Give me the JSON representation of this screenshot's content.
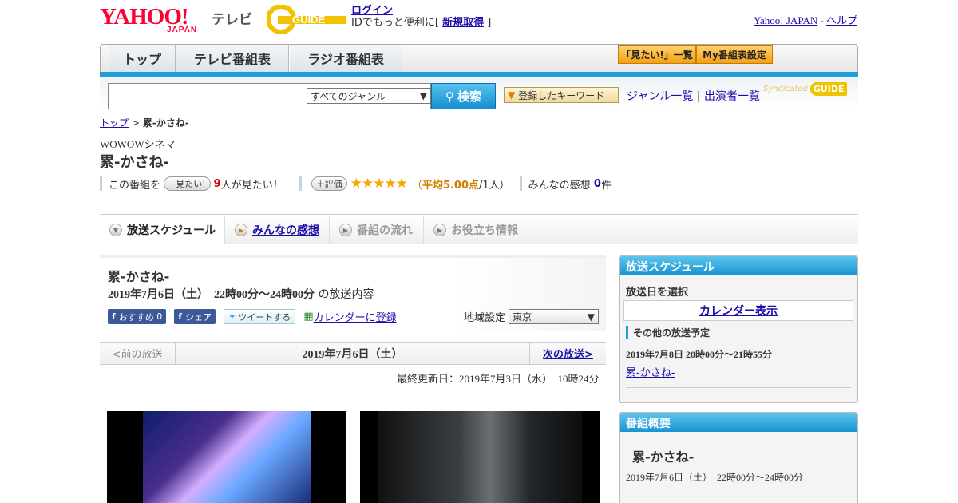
{
  "header": {
    "logo_main": "YAHOO!",
    "logo_sub": "JAPAN",
    "logo_tv": "テレビ",
    "gguide_logo": "GUIDE",
    "login_link": "ログイン",
    "login_text_prefix": "IDでもっと便利に[",
    "register_link": "新規取得",
    "login_text_suffix": "]",
    "yahoo_japan_link": "Yahoo! JAPAN",
    "dash": "-",
    "help_link": "ヘルプ"
  },
  "nav": {
    "tabs": [
      "トップ",
      "テレビ番組表",
      "ラジオ番組表"
    ],
    "mitai_list": "「見たい!」一覧",
    "my_schedule": "My番組表設定"
  },
  "search": {
    "placeholder": "",
    "genre_selected": "すべてのジャンル",
    "search_button": "検索",
    "keyword_button": "登録したキーワード",
    "genre_list_link": "ジャンル一覧",
    "divider": "|",
    "performer_link": "出演者一覧",
    "syndicated": "Syndicated",
    "syndicated_logo": "GUIDE"
  },
  "breadcrumb": {
    "top": "トップ",
    "sep": ">",
    "current": "累-かさね-"
  },
  "program": {
    "channel": "WOWOWシネマ",
    "title": "累-かさね-",
    "mitai_prefix": "この番組を",
    "mitai_button": "見たい!",
    "mitai_count": "9",
    "mitai_suffix": "人が見たい！",
    "rating_button": "評価",
    "stars": "★★★★★",
    "rating_open": "（",
    "rating_avg": "平均5.00点",
    "rating_rest": "/1人）",
    "impressions_label": "みんなの感想",
    "impressions_count": "0",
    "impressions_unit": "件"
  },
  "subtabs": [
    "放送スケジュール",
    "みんなの感想",
    "番組の流れ",
    "お役立ち情報"
  ],
  "main": {
    "title": "累-かさね-",
    "date": "2019年7月6日（土）　22時00分～24時00分",
    "date_suffix": "の放送内容",
    "recommend": "おすすめ",
    "recommend_count": "0",
    "share": "シェア",
    "tweet": "ツイートする",
    "calendar": "カレンダーに登録",
    "region_label": "地域設定",
    "region_value": "東京",
    "prev": "<前の放送",
    "current_date": "2019年7月6日（土）",
    "next": "次の放送>",
    "updated": "最終更新日：2019年7月3日（水）　10時24分"
  },
  "sidebar": {
    "schedule_head": "放送スケジュール",
    "select_date": "放送日を選択",
    "calendar_link": "カレンダー表示",
    "other_label": "その他の放送予定",
    "other_date": "2019年7月8日  20時00分～21時55分",
    "other_title": "累-かさね-",
    "overview_head": "番組概要",
    "overview_title": "累-かさね-",
    "overview_date": "2019年7月6日（土）　22時00分～24時00分"
  },
  "colors": {
    "accent_blue": "#1e9fd9",
    "yahoo_red": "#ff0033",
    "star_orange": "#f5a800",
    "gguide_yellow": "#f2c200"
  }
}
